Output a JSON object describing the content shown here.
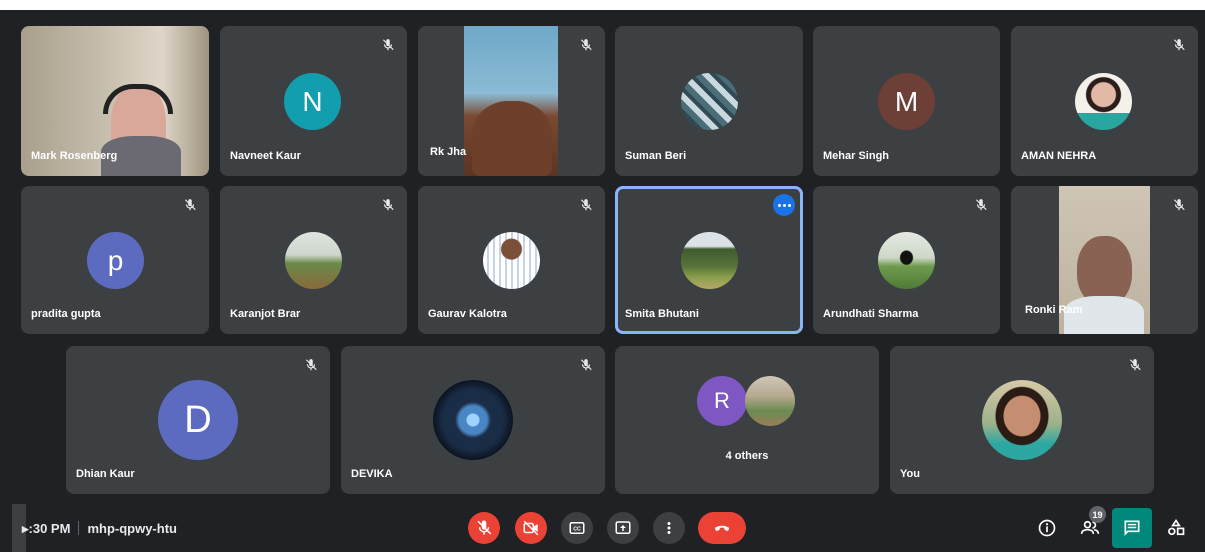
{
  "meeting": {
    "time": "▸:30 PM",
    "code": "mhp-qpwy-htu"
  },
  "participants": [
    {
      "name": "Mark Rosenberg"
    },
    {
      "name": "Navneet Kaur",
      "initial": "N"
    },
    {
      "name": "Rk Jha"
    },
    {
      "name": "Suman Beri"
    },
    {
      "name": "Mehar Singh",
      "initial": "M"
    },
    {
      "name": "AMAN NEHRA"
    },
    {
      "name": "pradita gupta",
      "initial": "p"
    },
    {
      "name": "Karanjot Brar"
    },
    {
      "name": "Gaurav Kalotra"
    },
    {
      "name": "Smita Bhutani"
    },
    {
      "name": "Arundhati Sharma"
    },
    {
      "name": "Ronki Ram"
    },
    {
      "name": "Dhian Kaur",
      "initial": "D"
    },
    {
      "name": "DEVIKA"
    },
    {
      "name": "4 others",
      "initial": "R"
    },
    {
      "name": "You"
    }
  ],
  "people_count": "19",
  "colors": {
    "accent": "#1a73e8",
    "danger": "#ea4335",
    "chat": "#00897b"
  }
}
